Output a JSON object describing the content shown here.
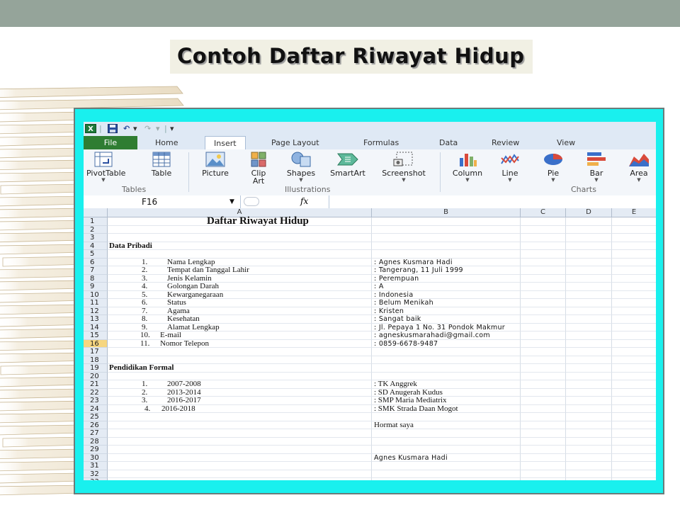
{
  "slide": {
    "title": "Contoh Daftar Riwayat Hidup"
  },
  "qat": {
    "undo_glyph": "↶",
    "redo_glyph": "↷",
    "dropdown_glyph": "▾"
  },
  "tabs": [
    "File",
    "Home",
    "Insert",
    "Page Layout",
    "Formulas",
    "Data",
    "Review",
    "View"
  ],
  "ribbon": {
    "buttons": [
      {
        "label": "PivotTable",
        "has_arrow": true
      },
      {
        "label": "Table",
        "has_arrow": false
      },
      {
        "label": "Picture",
        "has_arrow": false
      },
      {
        "label": "Clip",
        "label2": "Art"
      },
      {
        "label": "Shapes",
        "has_arrow": true
      },
      {
        "label": "SmartArt",
        "has_arrow": false
      },
      {
        "label": "Screenshot",
        "has_arrow": true
      },
      {
        "label": "Column",
        "has_arrow": true
      },
      {
        "label": "Line",
        "has_arrow": true
      },
      {
        "label": "Pie",
        "has_arrow": true
      },
      {
        "label": "Bar",
        "has_arrow": true
      },
      {
        "label": "Area",
        "has_arrow": true
      }
    ],
    "groups": [
      "Tables",
      "Illustrations",
      "Charts"
    ]
  },
  "formula_bar": {
    "name_box": "F16",
    "fx": "fx"
  },
  "columns": [
    "A",
    "B",
    "C",
    "D",
    "E"
  ],
  "selected_row": 16,
  "sheet": {
    "heading": "Daftar Riwayat Hidup",
    "section1": "Data Pribadi",
    "personal": [
      {
        "num": "1.",
        "label": "Nama Lengkap",
        "value": ": Agnes Kusmara Hadi"
      },
      {
        "num": "2.",
        "label": "Tempat dan Tanggal Lahir",
        "value": ": Tangerang, 11 Juli 1999"
      },
      {
        "num": "3.",
        "label": "Jenis Kelamin",
        "value": ": Perempuan"
      },
      {
        "num": "4.",
        "label": "Golongan Darah",
        "value": ": A"
      },
      {
        "num": "5.",
        "label": "Kewarganegaraan",
        "value": ": Indonesia"
      },
      {
        "num": "6.",
        "label": "Status",
        "value": ": Belum Menikah"
      },
      {
        "num": "7.",
        "label": "Agama",
        "value": ": Kristen"
      },
      {
        "num": "8.",
        "label": "Kesehatan",
        "value": ": Sangat baik"
      },
      {
        "num": "9.",
        "label": "Alamat Lengkap",
        "value": ": Jl. Pepaya 1 No. 31 Pondok Makmur"
      },
      {
        "num": "10.",
        "label": "E-mail",
        "value": ": agneskusmarahadi@gmail.com"
      },
      {
        "num": "11.",
        "label": "Nomor Telepon",
        "value": ": 0859-6678-9487"
      }
    ],
    "section2": "Pendidikan Formal",
    "education": [
      {
        "num": "1.",
        "years": "2007-2008",
        "school": ": TK Anggrek"
      },
      {
        "num": "2.",
        "years": "2013-2014",
        "school": ": SD Anugerah Kudus"
      },
      {
        "num": "3.",
        "years": "2016-2017",
        "school": ": SMP Maria Mediatrix"
      },
      {
        "num": "4.",
        "years": "2016-2018",
        "school": ": SMK Strada Daan Mogot"
      }
    ],
    "closing": "Hormat saya",
    "signature": "Agnes Kusmara Hadi"
  },
  "colors": {
    "accent_frame": "#19f0ee",
    "file_tab": "#2f7d32",
    "top_bar": "#95a49a"
  }
}
